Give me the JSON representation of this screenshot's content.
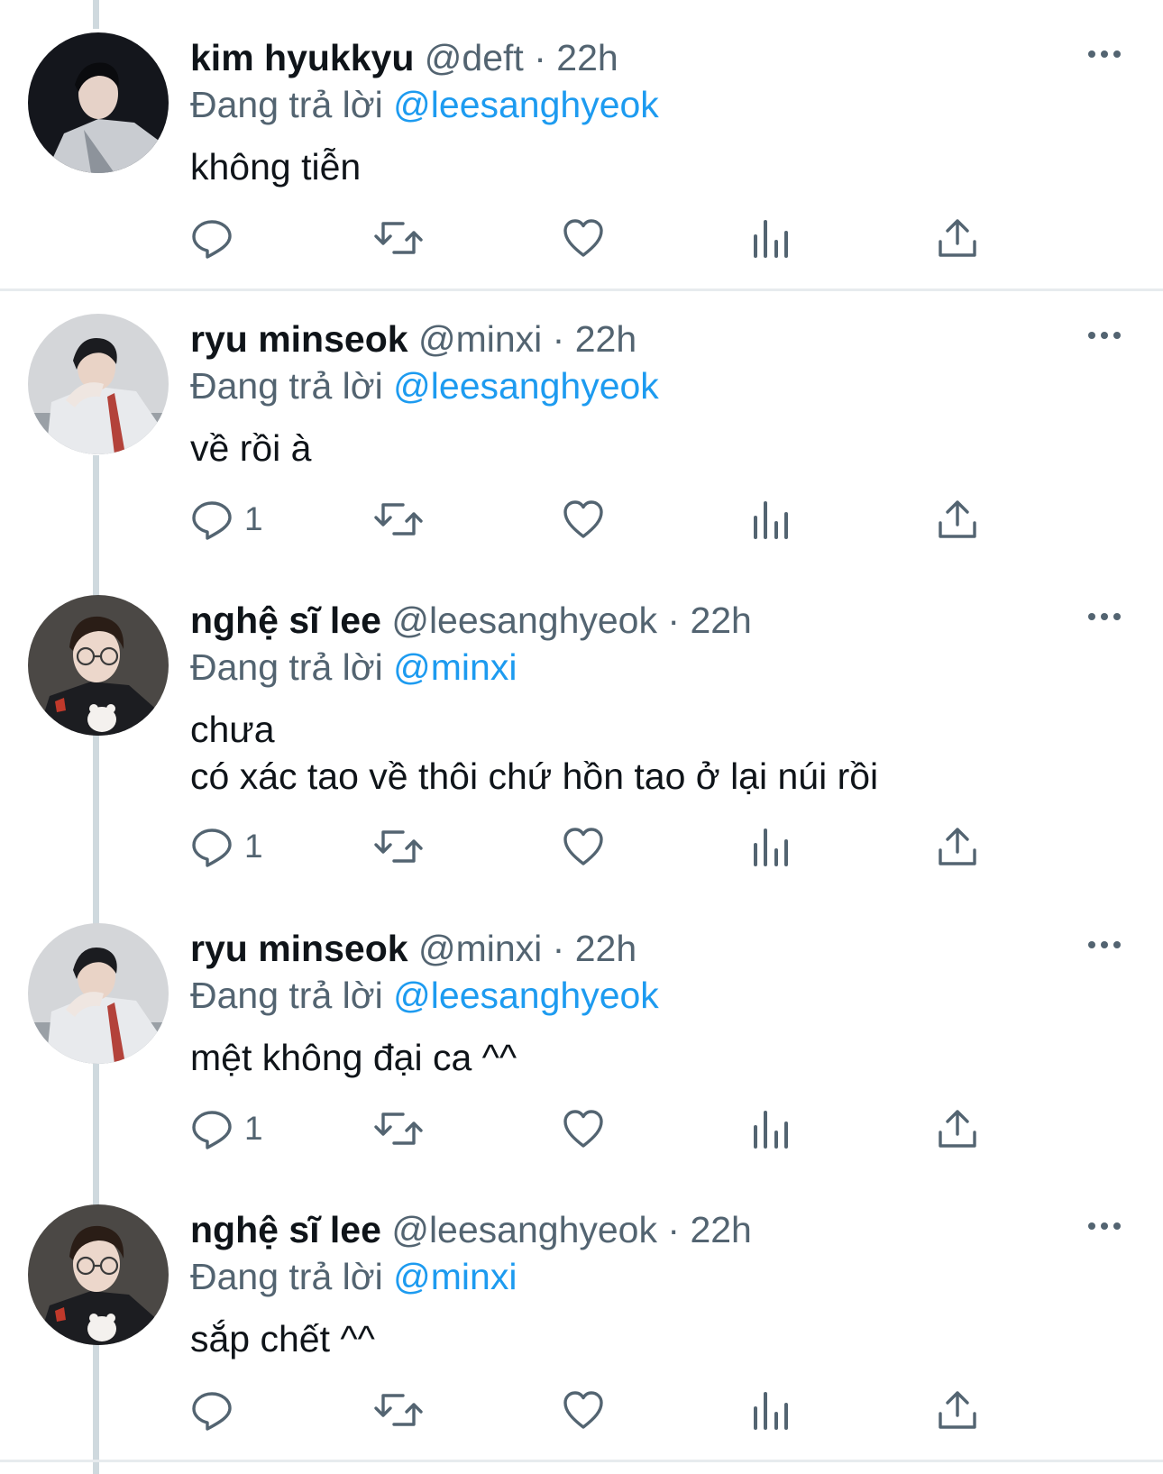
{
  "tweets": [
    {
      "name": "kim hyukkyu",
      "handle": "@deft",
      "separator": "·",
      "time": "22h",
      "reply_prefix": "Đang trả lời",
      "reply_to": "@leesanghyeok",
      "text": [
        "không tiễn"
      ],
      "reply_count": "",
      "avatar": "avatar-deft"
    },
    {
      "name": "ryu minseok",
      "handle": "@minxi",
      "separator": "·",
      "time": "22h",
      "reply_prefix": "Đang trả lời",
      "reply_to": "@leesanghyeok",
      "text": [
        "về rồi à"
      ],
      "reply_count": "1",
      "avatar": "avatar-minxi"
    },
    {
      "name": "nghệ sĩ lee",
      "handle": "@leesanghyeok",
      "separator": "·",
      "time": "22h",
      "reply_prefix": "Đang trả lời",
      "reply_to": "@minxi",
      "text": [
        "chưa",
        "có xác tao về thôi chứ hồn tao ở lại núi rồi"
      ],
      "reply_count": "1",
      "avatar": "avatar-leesanghyeok"
    },
    {
      "name": "ryu minseok",
      "handle": "@minxi",
      "separator": "·",
      "time": "22h",
      "reply_prefix": "Đang trả lời",
      "reply_to": "@leesanghyeok",
      "text": [
        "mệt không đại ca ^^"
      ],
      "reply_count": "1",
      "avatar": "avatar-minxi"
    },
    {
      "name": "nghệ sĩ lee",
      "handle": "@leesanghyeok",
      "separator": "·",
      "time": "22h",
      "reply_prefix": "Đang trả lời",
      "reply_to": "@minxi",
      "text": [
        "sắp chết ^^"
      ],
      "reply_count": "",
      "avatar": "avatar-leesanghyeok"
    }
  ],
  "icons": {
    "more": "more-dots-icon",
    "reply": "reply-bubble-icon",
    "retweet": "retweet-icon",
    "like": "heart-icon",
    "views": "analytics-bars-icon",
    "share": "share-upload-icon"
  },
  "colors": {
    "text": "#0f1419",
    "muted": "#536471",
    "mention": "#1d9bf0",
    "thread_line": "#cfd9de",
    "divider": "#e7ebee"
  }
}
